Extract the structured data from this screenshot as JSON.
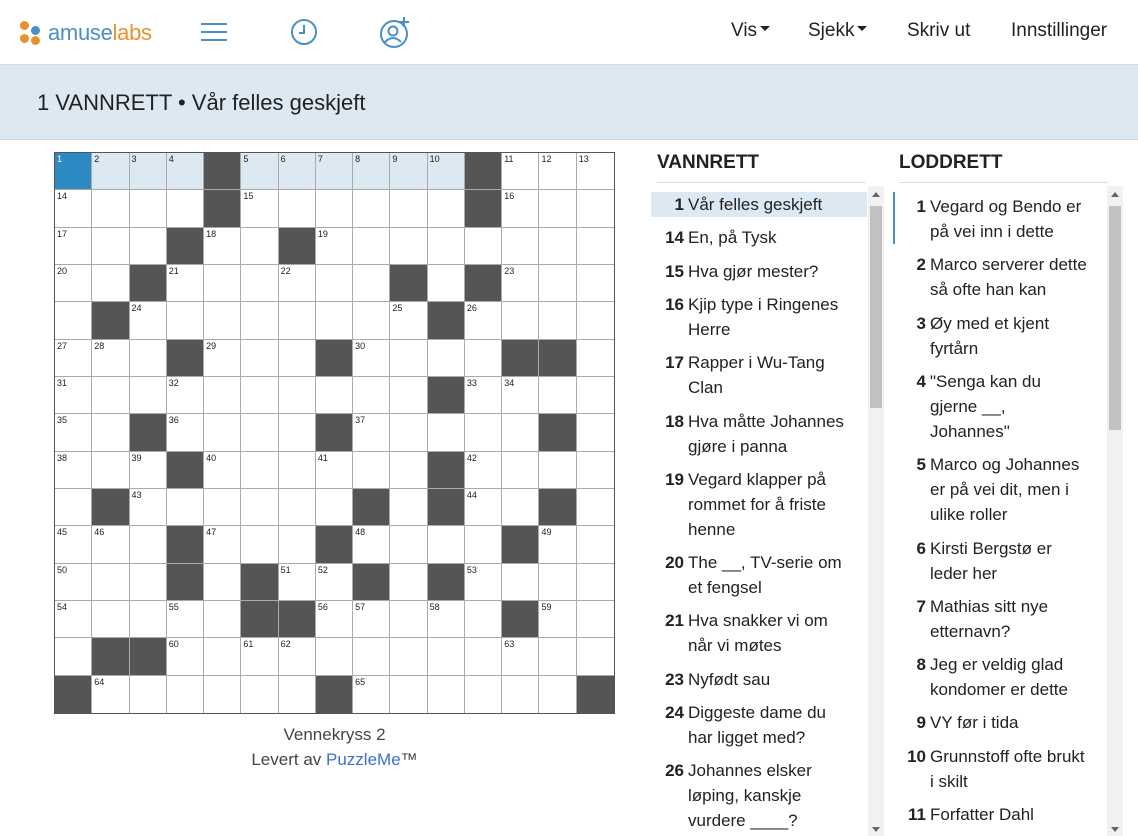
{
  "topbar": {
    "logo_a": "amuse",
    "logo_b": "labs",
    "menu": {
      "show": "Vis",
      "check": "Sjekk",
      "print": "Skriv ut",
      "settings": "Innstillinger"
    },
    "icons": [
      "hamburger-icon",
      "clock-icon",
      "add-user-icon"
    ]
  },
  "current_clue": "1 VANNRETT • Vår felles geskjeft",
  "puzzle": {
    "rows": 15,
    "cols": 15,
    "black": [
      [
        0,
        4
      ],
      [
        0,
        11
      ],
      [
        1,
        4
      ],
      [
        1,
        11
      ],
      [
        2,
        3
      ],
      [
        2,
        6
      ],
      [
        3,
        2
      ],
      [
        3,
        9
      ],
      [
        3,
        11
      ],
      [
        4,
        1
      ],
      [
        4,
        10
      ],
      [
        5,
        3
      ],
      [
        5,
        7
      ],
      [
        5,
        12
      ],
      [
        5,
        13
      ],
      [
        6,
        10
      ],
      [
        7,
        2
      ],
      [
        7,
        7
      ],
      [
        7,
        13
      ],
      [
        8,
        3
      ],
      [
        8,
        10
      ],
      [
        9,
        1
      ],
      [
        9,
        8
      ],
      [
        9,
        10
      ],
      [
        9,
        13
      ],
      [
        10,
        3
      ],
      [
        10,
        7
      ],
      [
        10,
        12
      ],
      [
        11,
        3
      ],
      [
        11,
        5
      ],
      [
        11,
        8
      ],
      [
        11,
        10
      ],
      [
        12,
        5
      ],
      [
        12,
        6
      ],
      [
        12,
        12
      ],
      [
        13,
        1
      ],
      [
        13,
        2
      ],
      [
        14,
        0
      ],
      [
        14,
        7
      ],
      [
        14,
        14
      ]
    ],
    "numbers": [
      [
        0,
        0,
        "1"
      ],
      [
        0,
        1,
        "2"
      ],
      [
        0,
        2,
        "3"
      ],
      [
        0,
        3,
        "4"
      ],
      [
        0,
        5,
        "5"
      ],
      [
        0,
        6,
        "6"
      ],
      [
        0,
        7,
        "7"
      ],
      [
        0,
        8,
        "8"
      ],
      [
        0,
        9,
        "9"
      ],
      [
        0,
        10,
        "10"
      ],
      [
        0,
        12,
        "11"
      ],
      [
        0,
        13,
        "12"
      ],
      [
        0,
        14,
        "13"
      ],
      [
        1,
        0,
        "14"
      ],
      [
        1,
        5,
        "15"
      ],
      [
        1,
        12,
        "16"
      ],
      [
        2,
        0,
        "17"
      ],
      [
        2,
        4,
        "18"
      ],
      [
        2,
        7,
        "19"
      ],
      [
        3,
        0,
        "20"
      ],
      [
        3,
        3,
        "21"
      ],
      [
        3,
        6,
        "22"
      ],
      [
        3,
        12,
        "23"
      ],
      [
        4,
        2,
        "24"
      ],
      [
        4,
        9,
        "25"
      ],
      [
        4,
        11,
        "26"
      ],
      [
        5,
        0,
        "27"
      ],
      [
        5,
        1,
        "28"
      ],
      [
        5,
        4,
        "29"
      ],
      [
        5,
        8,
        "30"
      ],
      [
        6,
        0,
        "31"
      ],
      [
        6,
        3,
        "32"
      ],
      [
        6,
        11,
        "33"
      ],
      [
        6,
        12,
        "34"
      ],
      [
        7,
        0,
        "35"
      ],
      [
        7,
        3,
        "36"
      ],
      [
        7,
        8,
        "37"
      ],
      [
        8,
        0,
        "38"
      ],
      [
        8,
        2,
        "39"
      ],
      [
        8,
        4,
        "40"
      ],
      [
        8,
        7,
        "41"
      ],
      [
        8,
        11,
        "42"
      ],
      [
        9,
        2,
        "43"
      ],
      [
        9,
        11,
        "44"
      ],
      [
        10,
        0,
        "45"
      ],
      [
        10,
        1,
        "46"
      ],
      [
        10,
        4,
        "47"
      ],
      [
        10,
        8,
        "48"
      ],
      [
        10,
        13,
        "49"
      ],
      [
        11,
        0,
        "50"
      ],
      [
        11,
        6,
        "51"
      ],
      [
        11,
        7,
        "52"
      ],
      [
        11,
        11,
        "53"
      ],
      [
        12,
        0,
        "54"
      ],
      [
        12,
        3,
        "55"
      ],
      [
        12,
        7,
        "56"
      ],
      [
        12,
        8,
        "57"
      ],
      [
        12,
        10,
        "58"
      ],
      [
        12,
        13,
        "59"
      ],
      [
        13,
        3,
        "60"
      ],
      [
        13,
        5,
        "61"
      ],
      [
        13,
        6,
        "62"
      ],
      [
        13,
        12,
        "63"
      ],
      [
        14,
        1,
        "64"
      ],
      [
        14,
        8,
        "65"
      ]
    ],
    "title": "Vennekryss 2",
    "provided_by": "Levert av",
    "provider_link": "PuzzleMe",
    "trademark": "™"
  },
  "across": {
    "heading": "VANNRETT",
    "clues": [
      {
        "n": "1",
        "lines": [
          "Vår felles geskjeft"
        ]
      },
      {
        "n": "14",
        "lines": [
          "En, på Tysk"
        ]
      },
      {
        "n": "15",
        "lines": [
          "Hva gjør mester?"
        ]
      },
      {
        "n": "16",
        "lines": [
          "Kjip type i Ringenes",
          "Herre"
        ]
      },
      {
        "n": "17",
        "lines": [
          "Rapper i Wu-Tang",
          "Clan"
        ]
      },
      {
        "n": "18",
        "lines": [
          "Hva måtte Johannes",
          "gjøre i panna"
        ]
      },
      {
        "n": "19",
        "lines": [
          "Vegard klapper på",
          "rommet for å friste",
          "henne"
        ]
      },
      {
        "n": "20",
        "lines": [
          "The __, TV-serie om",
          "et fengsel"
        ]
      },
      {
        "n": "21",
        "lines": [
          "Hva snakker vi om",
          "når vi møtes"
        ]
      },
      {
        "n": "23",
        "lines": [
          "Nyfødt sau"
        ]
      },
      {
        "n": "24",
        "lines": [
          "Diggeste dame du",
          "har ligget med?"
        ]
      },
      {
        "n": "26",
        "lines": [
          "Johannes elsker",
          "løping, kanskje",
          "vurdere ____?"
        ]
      }
    ]
  },
  "down": {
    "heading": "LODDRETT",
    "clues": [
      {
        "n": "1",
        "lines": [
          "Vegard og Bendo er",
          "på vei inn i dette"
        ]
      },
      {
        "n": "2",
        "lines": [
          "Marco serverer dette",
          "så ofte han kan"
        ]
      },
      {
        "n": "3",
        "lines": [
          "Øy med et kjent",
          "fyrtårn"
        ]
      },
      {
        "n": "4",
        "lines": [
          "\"Senga kan du",
          "gjerne __,",
          "Johannes\""
        ]
      },
      {
        "n": "5",
        "lines": [
          "Marco og Johannes",
          "er på vei dit, men i",
          "ulike roller"
        ]
      },
      {
        "n": "6",
        "lines": [
          "Kirsti Bergstø er",
          "leder her"
        ]
      },
      {
        "n": "7",
        "lines": [
          "Mathias sitt nye",
          "etternavn?"
        ]
      },
      {
        "n": "8",
        "lines": [
          "Jeg er veldig glad",
          "kondomer er dette"
        ]
      },
      {
        "n": "9",
        "lines": [
          "VY før i tida"
        ]
      },
      {
        "n": "10",
        "lines": [
          "Grunnstoff ofte brukt",
          "i skilt"
        ]
      },
      {
        "n": "11",
        "lines": [
          "Forfatter Dahl"
        ]
      }
    ]
  }
}
